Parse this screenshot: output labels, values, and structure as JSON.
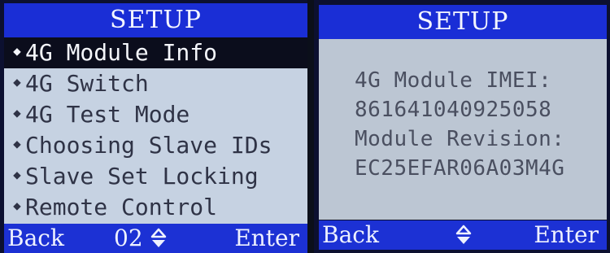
{
  "left_panel": {
    "title": "SETUP",
    "menu_items": [
      {
        "label": "4G Module Info",
        "selected": true
      },
      {
        "label": "4G Switch",
        "selected": false
      },
      {
        "label": "4G Test Mode",
        "selected": false
      },
      {
        "label": "Choosing Slave IDs",
        "selected": false
      },
      {
        "label": "Slave Set Locking",
        "selected": false
      },
      {
        "label": "Remote Control",
        "selected": false
      }
    ],
    "bullet_glyph": "◆",
    "footer": {
      "back": "Back",
      "page": "02",
      "enter": "Enter"
    }
  },
  "right_panel": {
    "title": "SETUP",
    "lines": [
      "4G Module IMEI:",
      "861641040925058",
      "Module Revision:",
      "EC25EFAR06A03M4G"
    ],
    "footer": {
      "back": "Back",
      "enter": "Enter"
    }
  },
  "colors": {
    "header_blue": "#1a2ed6",
    "menu_bg": "#c6d2e2",
    "selected_bg": "#0b0d1c",
    "info_bg": "#bcc6d3"
  }
}
